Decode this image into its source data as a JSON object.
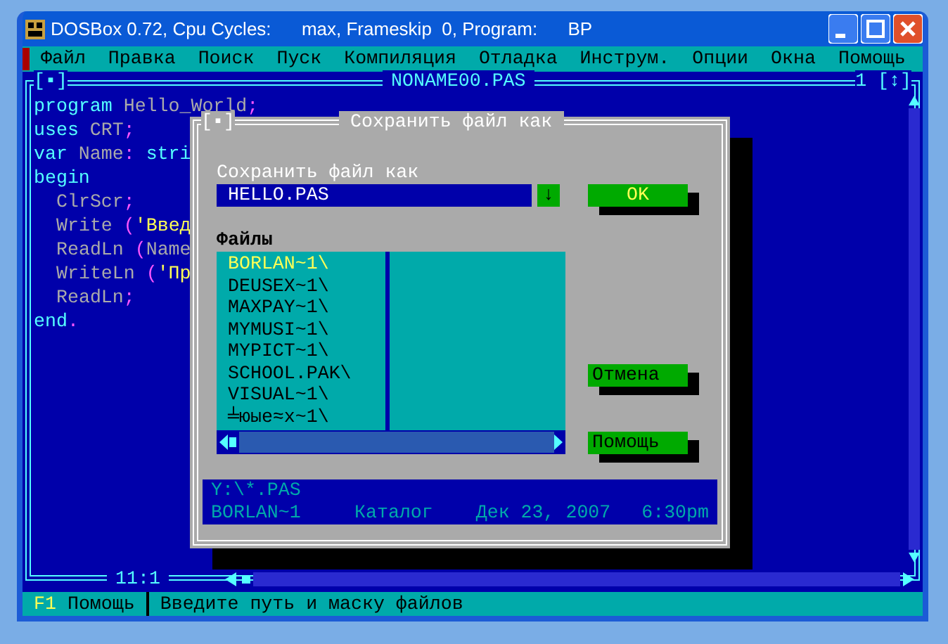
{
  "window": {
    "title": "DOSBox 0.72, Cpu Cycles:      max, Frameskip  0, Program:      BP"
  },
  "menu": [
    {
      "label": "Файл"
    },
    {
      "label": "Правка"
    },
    {
      "label": "Поиск"
    },
    {
      "label": "Пуск"
    },
    {
      "label": "Компиляция"
    },
    {
      "label": "Отладка"
    },
    {
      "label": "Инструм."
    },
    {
      "label": "Опции"
    },
    {
      "label": "Окна"
    },
    {
      "label": "Помощь"
    }
  ],
  "editor": {
    "title": "NONAME00.PAS",
    "close_button": "[▪]",
    "window_number": "1",
    "zoom_button": "[↕]",
    "position": "11:1",
    "lines": [
      {
        "indented": false,
        "segments": [
          {
            "text": "program",
            "kind": "keyword"
          },
          {
            "text": " Hello_World",
            "kind": "ident"
          },
          {
            "text": ";",
            "kind": "symbol"
          }
        ]
      },
      {
        "indented": false,
        "segments": [
          {
            "text": "uses",
            "kind": "keyword"
          },
          {
            "text": " CRT",
            "kind": "ident"
          },
          {
            "text": ";",
            "kind": "symbol"
          }
        ]
      },
      {
        "indented": false,
        "segments": [
          {
            "text": "var",
            "kind": "keyword"
          },
          {
            "text": " Name",
            "kind": "ident"
          },
          {
            "text": ":",
            "kind": "symbol"
          },
          {
            "text": " stri",
            "kind": "keyword"
          }
        ]
      },
      {
        "indented": false,
        "segments": [
          {
            "text": "begin",
            "kind": "keyword"
          }
        ]
      },
      {
        "indented": true,
        "segments": [
          {
            "text": "ClrScr",
            "kind": "ident"
          },
          {
            "text": ";",
            "kind": "symbol"
          }
        ]
      },
      {
        "indented": true,
        "segments": [
          {
            "text": "Write ",
            "kind": "ident"
          },
          {
            "text": "(",
            "kind": "symbol"
          },
          {
            "text": "'Введ",
            "kind": "string"
          }
        ]
      },
      {
        "indented": true,
        "segments": [
          {
            "text": "ReadLn ",
            "kind": "ident"
          },
          {
            "text": "(",
            "kind": "symbol"
          },
          {
            "text": "Name",
            "kind": "ident"
          }
        ]
      },
      {
        "indented": true,
        "segments": [
          {
            "text": "WriteLn ",
            "kind": "ident"
          },
          {
            "text": "(",
            "kind": "symbol"
          },
          {
            "text": "'Пр",
            "kind": "string"
          }
        ]
      },
      {
        "indented": true,
        "segments": [
          {
            "text": "ReadLn",
            "kind": "ident"
          },
          {
            "text": ";",
            "kind": "symbol"
          }
        ]
      },
      {
        "indented": false,
        "segments": [
          {
            "text": "end",
            "kind": "keyword"
          },
          {
            "text": ".",
            "kind": "symbol"
          }
        ]
      }
    ]
  },
  "dialog": {
    "title": "Сохранить файл как",
    "close_button": "[▪]",
    "name_label": "Сохранить файл как",
    "name_value": "HELLO.PAS",
    "history_button": "↓",
    "files_label": "Файлы",
    "files": [
      {
        "name": "BORLAN~1\\",
        "selected": true
      },
      {
        "name": "DEUSEX~1\\",
        "selected": false
      },
      {
        "name": "MAXPAY~1\\",
        "selected": false
      },
      {
        "name": "MYMUSI~1\\",
        "selected": false
      },
      {
        "name": "MYPICT~1\\",
        "selected": false
      },
      {
        "name": "SCHOOL.PAK\\",
        "selected": false
      },
      {
        "name": "VISUAL~1\\",
        "selected": false
      },
      {
        "name": "╧юые≈х~1\\",
        "selected": false
      }
    ],
    "buttons": [
      {
        "label": "OK",
        "kind": "default"
      },
      {
        "label": "Отмена",
        "kind": "normal"
      },
      {
        "label": "Помощь",
        "kind": "normal"
      }
    ],
    "info": {
      "path": "Y:\\*.PAS",
      "name": "BORLAN~1",
      "type": "Каталог",
      "date": "Дек 23, 2007",
      "time": "6:30pm"
    }
  },
  "status_bar": {
    "key": "F1",
    "key_label": "Помощь",
    "hint": "Введите путь и маску файлов"
  }
}
